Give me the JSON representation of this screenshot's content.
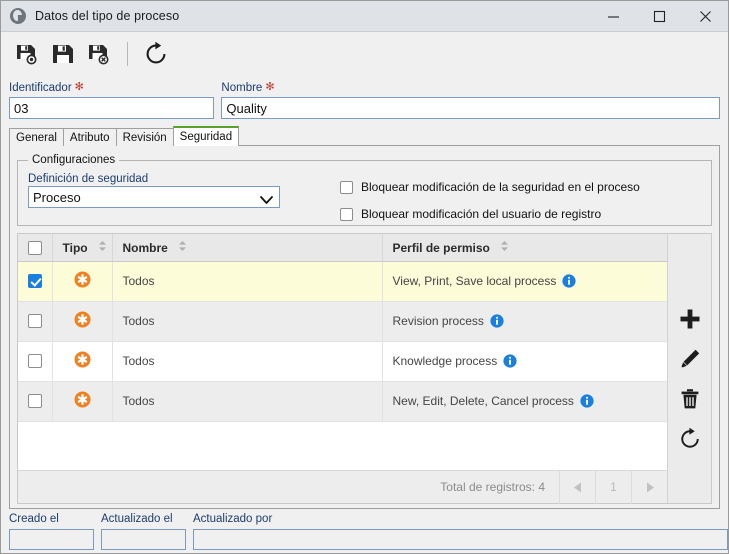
{
  "window": {
    "title": "Datos del tipo de proceso",
    "icon": "globe-icon",
    "minimize_label": "—",
    "maximize_label": "□",
    "close_label": "✕"
  },
  "toolbar": {
    "buttons": [
      {
        "name": "save-and-new-button",
        "icon": "save-new-icon",
        "label": "Guardar y nuevo"
      },
      {
        "name": "save-button",
        "icon": "save-icon",
        "label": "Guardar"
      },
      {
        "name": "save-and-close-button",
        "icon": "save-close-icon",
        "label": "Guardar y cerrar"
      },
      {
        "name": "refresh-button",
        "icon": "refresh-icon",
        "label": "Actualizar"
      }
    ]
  },
  "form": {
    "identificador": {
      "label": "Identificador",
      "required_mark": "✻",
      "value": "03",
      "placeholder": ""
    },
    "nombre": {
      "label": "Nombre",
      "required_mark": "✻",
      "value": "Quality",
      "placeholder": ""
    }
  },
  "tabs": [
    {
      "label": "General",
      "active": false
    },
    {
      "label": "Atributo",
      "active": false
    },
    {
      "label": "Revisión",
      "active": false
    },
    {
      "label": "Seguridad",
      "active": true
    }
  ],
  "configuraciones": {
    "legend": "Configuraciones",
    "definicion_label": "Definición de seguridad",
    "definicion_value": "Proceso",
    "definicion_options": [
      "Proceso"
    ],
    "checkbox_1": {
      "label": "Bloquear modificación de la seguridad en el proceso",
      "checked": false
    },
    "checkbox_2": {
      "label": "Bloquear modificación del usuario de registro",
      "checked": false
    }
  },
  "grid": {
    "columns": [
      {
        "key": "check",
        "label": ""
      },
      {
        "key": "tipo",
        "label": "Tipo",
        "sortable": true
      },
      {
        "key": "nombre",
        "label": "Nombre",
        "sortable": true
      },
      {
        "key": "perfil",
        "label": "Perfil de permiso",
        "sortable": true
      }
    ],
    "header_checkbox_checked": false,
    "rows": [
      {
        "checked": true,
        "tipo_icon": "asterisk-badge-icon",
        "nombre": "Todos",
        "perfil": "View, Print, Save local process",
        "info_icon": "info-icon",
        "selected": true
      },
      {
        "checked": false,
        "tipo_icon": "asterisk-badge-icon",
        "nombre": "Todos",
        "perfil": "Revision process",
        "info_icon": "info-icon",
        "selected": false
      },
      {
        "checked": false,
        "tipo_icon": "asterisk-badge-icon",
        "nombre": "Todos",
        "perfil": "Knowledge process",
        "info_icon": "info-icon",
        "selected": false
      },
      {
        "checked": false,
        "tipo_icon": "asterisk-badge-icon",
        "nombre": "Todos",
        "perfil": "New, Edit, Delete, Cancel process",
        "info_icon": "info-icon",
        "selected": false
      }
    ],
    "footer": {
      "total_label": "Total de registros: 4",
      "prev_label": "◀",
      "page_label": "1",
      "next_label": "▶"
    },
    "actions": [
      {
        "name": "add-record-button",
        "icon": "plus-icon",
        "label": "Agregar"
      },
      {
        "name": "edit-record-button",
        "icon": "pencil-icon",
        "label": "Editar"
      },
      {
        "name": "delete-record-button",
        "icon": "trash-icon",
        "label": "Eliminar"
      },
      {
        "name": "refresh-grid-button",
        "icon": "refresh-icon",
        "label": "Actualizar"
      }
    ]
  },
  "footer": {
    "creado_el": {
      "label": "Creado el",
      "value": "",
      "placeholder": ""
    },
    "actualizado_el": {
      "label": "Actualizado el",
      "value": "",
      "placeholder": ""
    },
    "actualizado_por": {
      "label": "Actualizado por",
      "value": "",
      "placeholder": ""
    }
  },
  "colors": {
    "accent_tab": "#5aa02c",
    "selected_row": "#fdfcd9",
    "checkbox_checked": "#1b7fe0",
    "tipo_icon": "#f08020",
    "info_icon": "#1b7fe0",
    "required": "#c0392b",
    "label_text": "#1d3c6e"
  }
}
